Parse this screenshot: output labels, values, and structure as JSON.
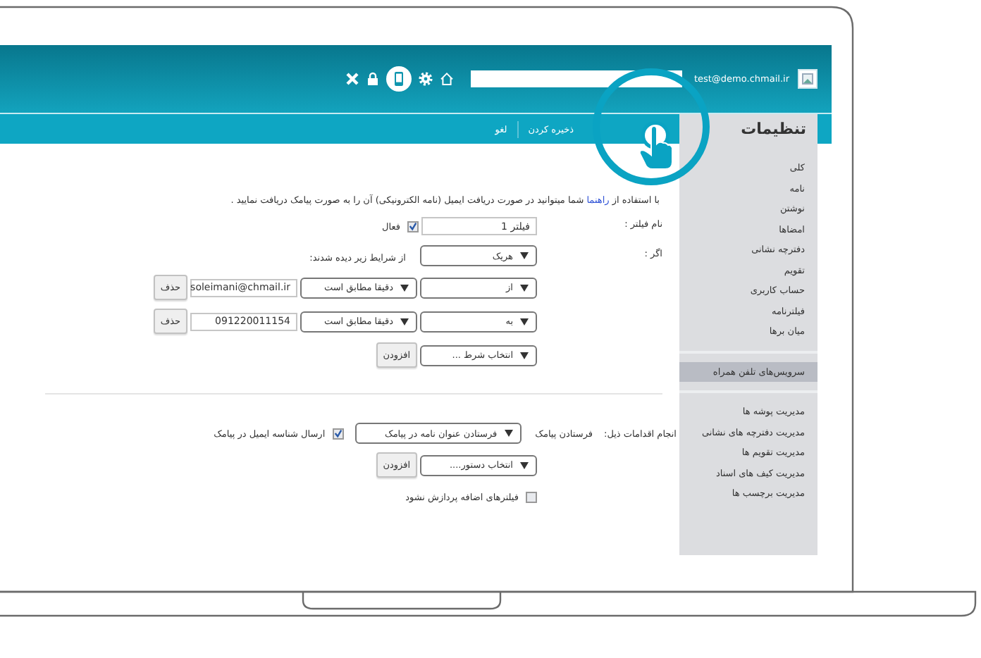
{
  "header": {
    "user_email": "test@demo.chmail.ir"
  },
  "toolbar": {
    "title": "تنظیمات",
    "actions": [
      "ذخیره کردن",
      "لغو"
    ]
  },
  "sidebar": {
    "groups": [
      {
        "items": [
          {
            "label": "کلی",
            "selected": false
          },
          {
            "label": "نامه",
            "selected": false
          },
          {
            "label": "نوشتن",
            "selected": false
          },
          {
            "label": "امضاها",
            "selected": false
          },
          {
            "label": "دفترچه نشانی",
            "selected": false
          },
          {
            "label": "تقویم",
            "selected": false
          },
          {
            "label": "حساب کاربری",
            "selected": false
          },
          {
            "label": "فیلترنامه",
            "selected": false
          },
          {
            "label": "میان برها",
            "selected": false
          }
        ]
      },
      {
        "items": [
          {
            "label": "سرویس‌های تلفن همراه",
            "selected": true
          }
        ]
      },
      {
        "items": [
          {
            "label": "مدیریت پوشه ها",
            "selected": false
          },
          {
            "label": "مدیریت دفترچه های نشانی",
            "selected": false
          },
          {
            "label": "مدیریت تقویم ها",
            "selected": false
          },
          {
            "label": "مدیریت کیف های اسناد",
            "selected": false
          },
          {
            "label": "مدیریت برچسب ها",
            "selected": false
          }
        ]
      }
    ]
  },
  "intro": {
    "before": "با استفاده از ",
    "link": "راهنما",
    "after": " شما میتوانید در صورت دریافت ایمیل (نامه الکترونیکی) آن را به صورت پیامک دریافت نمایید ."
  },
  "filter_name": {
    "label": "نام فیلتر :",
    "value": "فیلتر 1",
    "active": {
      "label": "فعال",
      "checked": true
    }
  },
  "conditions": {
    "label": "اگر :",
    "match": "هریک",
    "match_note": "از شرایط زیر دیده شدند:",
    "rows": [
      {
        "field": "از",
        "operator": "دقیقا مطابق است",
        "value": "soleimani@chmail.ir",
        "remove": "حذف"
      },
      {
        "field": "به",
        "operator": "دقیقا مطابق است",
        "value": "091220011154",
        "remove": "حذف"
      }
    ],
    "add_select": "انتخاب شرط ...",
    "add_button": "افزودن"
  },
  "actions": {
    "label": "انجام اقدامات ذیل:",
    "rows": [
      {
        "action": "فرستادن پیامک",
        "option": "فرستادن عنوان نامه در پیامک",
        "checkbox": {
          "label": "ارسال شناسه ایمیل در پیامک",
          "checked": true
        }
      }
    ],
    "add_select": "انتخاب دستور....",
    "add_button": "افزودن"
  },
  "stop_processing": {
    "label": "فیلترهای اضافه پردازش نشود",
    "checked": false
  }
}
